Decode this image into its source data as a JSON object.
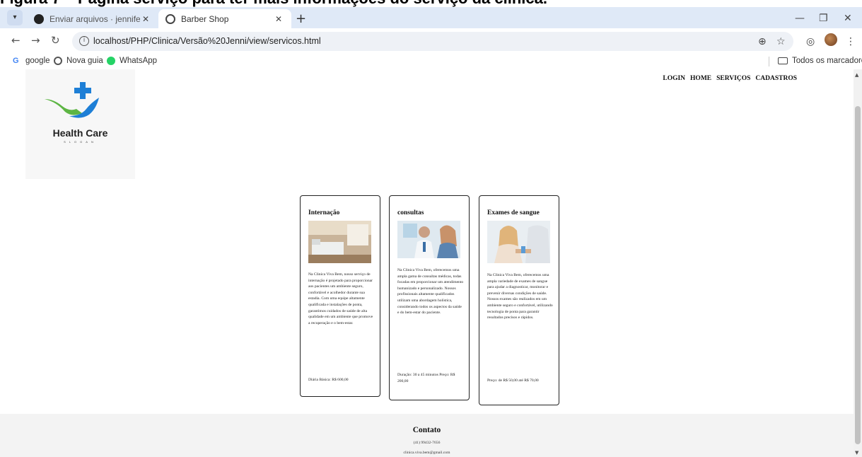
{
  "document": {
    "caption": "Figura 7 – Página serviço para ter mais informações do serviço da clínica."
  },
  "browser": {
    "tabs": [
      {
        "title": "Enviar arquivos · jennifercristin",
        "active": false
      },
      {
        "title": "Barber Shop",
        "active": true
      }
    ],
    "url": "localhost/PHP/Clinica/Versão%20Jenni/view/servicos.html",
    "bookmarks": [
      {
        "label": "google"
      },
      {
        "label": "Nova guia"
      },
      {
        "label": "WhatsApp"
      }
    ],
    "bookmarks_folder": "Todos os marcadores"
  },
  "logo": {
    "title": "Health Care",
    "slogan": "SLOGAN"
  },
  "nav": [
    "LOGIN",
    "HOME",
    "SERVIÇOS",
    "CADASTROS"
  ],
  "cards": [
    {
      "title": "Internação",
      "text": "Na Clinica Viva Bem, nosso serviço de internação é projetado para proporcionar aos pacientes um ambiente seguro, confortável e acolhedor durante sua estadia. Com uma equipe altamente qualificada e instalações de ponta, garantimos cuidados de saúde de alta qualidade em um ambiente que promove a recuperação e o bem-estar.",
      "price": "Diária Básica: R$ 600,00"
    },
    {
      "title": "consultas",
      "text": "Na Clinica Viva Bem, oferecemos uma ampla gama de consultas médicas, todas focadas em proporcionar um atendimento humanizado e personalizado. Nossos profissionais altamente qualificados utilizam uma abordagem holística, considerando todos os aspectos da saúde e do bem-estar do paciente.",
      "price": "Duração: 30 a 45 minutos Preço: R$ 200,00"
    },
    {
      "title": "Exames de sangue",
      "text": "Na Clinica Viva Bem, oferecemos uma ampla variedade de exames de sangue para ajudar a diagnosticar, monitorar e prevenir diversas condições de saúde. Nossos exames são realizados em um ambiente seguro e confortável, utilizando tecnologia de ponta para garantir resultados precisos e rápidos.",
      "price": "Preço: de R$ 50,00 até R$ 70,00"
    }
  ],
  "footer": {
    "title": "Contato",
    "phone": "(41) 99432-7656",
    "email": "clinica.viva.bem@gmail.com"
  }
}
